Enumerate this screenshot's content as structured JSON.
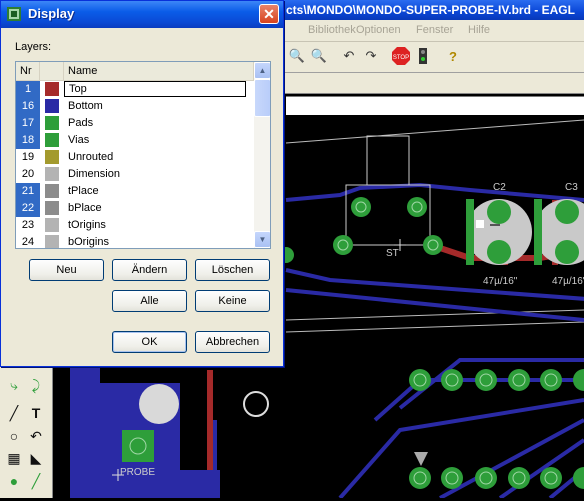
{
  "main_window": {
    "title": "cts\\MONDO\\MONDO-SUPER-PROBE-IV.brd - EAGL",
    "menu": [
      "Bibliothek",
      "Optionen",
      "Fenster",
      "Hilfe"
    ]
  },
  "canvas": {
    "labels": [
      "C2",
      "C3",
      "ST",
      "47µ/16\"",
      "47µ/16\"",
      "PROBE"
    ]
  },
  "dialog": {
    "title": "Display",
    "close_label": "✕",
    "layers_label": "Layers:",
    "columns": [
      "Nr",
      "Name"
    ],
    "layers": [
      {
        "nr": "1",
        "name": "Top",
        "color": "#a52a2a",
        "selected": true
      },
      {
        "nr": "16",
        "name": "Bottom",
        "color": "#2a2aa5",
        "selected": true
      },
      {
        "nr": "17",
        "name": "Pads",
        "color": "#2e9e3a",
        "selected": true
      },
      {
        "nr": "18",
        "name": "Vias",
        "color": "#2e9e3a",
        "selected": true
      },
      {
        "nr": "19",
        "name": "Unrouted",
        "color": "#a39a2e",
        "selected": false
      },
      {
        "nr": "20",
        "name": "Dimension",
        "color": "#b3b3b3",
        "selected": false
      },
      {
        "nr": "21",
        "name": "tPlace",
        "color": "#8c8c8c",
        "selected": true
      },
      {
        "nr": "22",
        "name": "bPlace",
        "color": "#8c8c8c",
        "selected": true
      },
      {
        "nr": "23",
        "name": "tOrigins",
        "color": "#b3b3b3",
        "selected": false
      },
      {
        "nr": "24",
        "name": "bOrigins",
        "color": "#b3b3b3",
        "selected": false
      }
    ],
    "buttons": {
      "new": "Neu",
      "change": "Ändern",
      "delete": "Löschen",
      "all": "Alle",
      "none": "Keine",
      "ok": "OK",
      "cancel": "Abbrechen"
    }
  }
}
